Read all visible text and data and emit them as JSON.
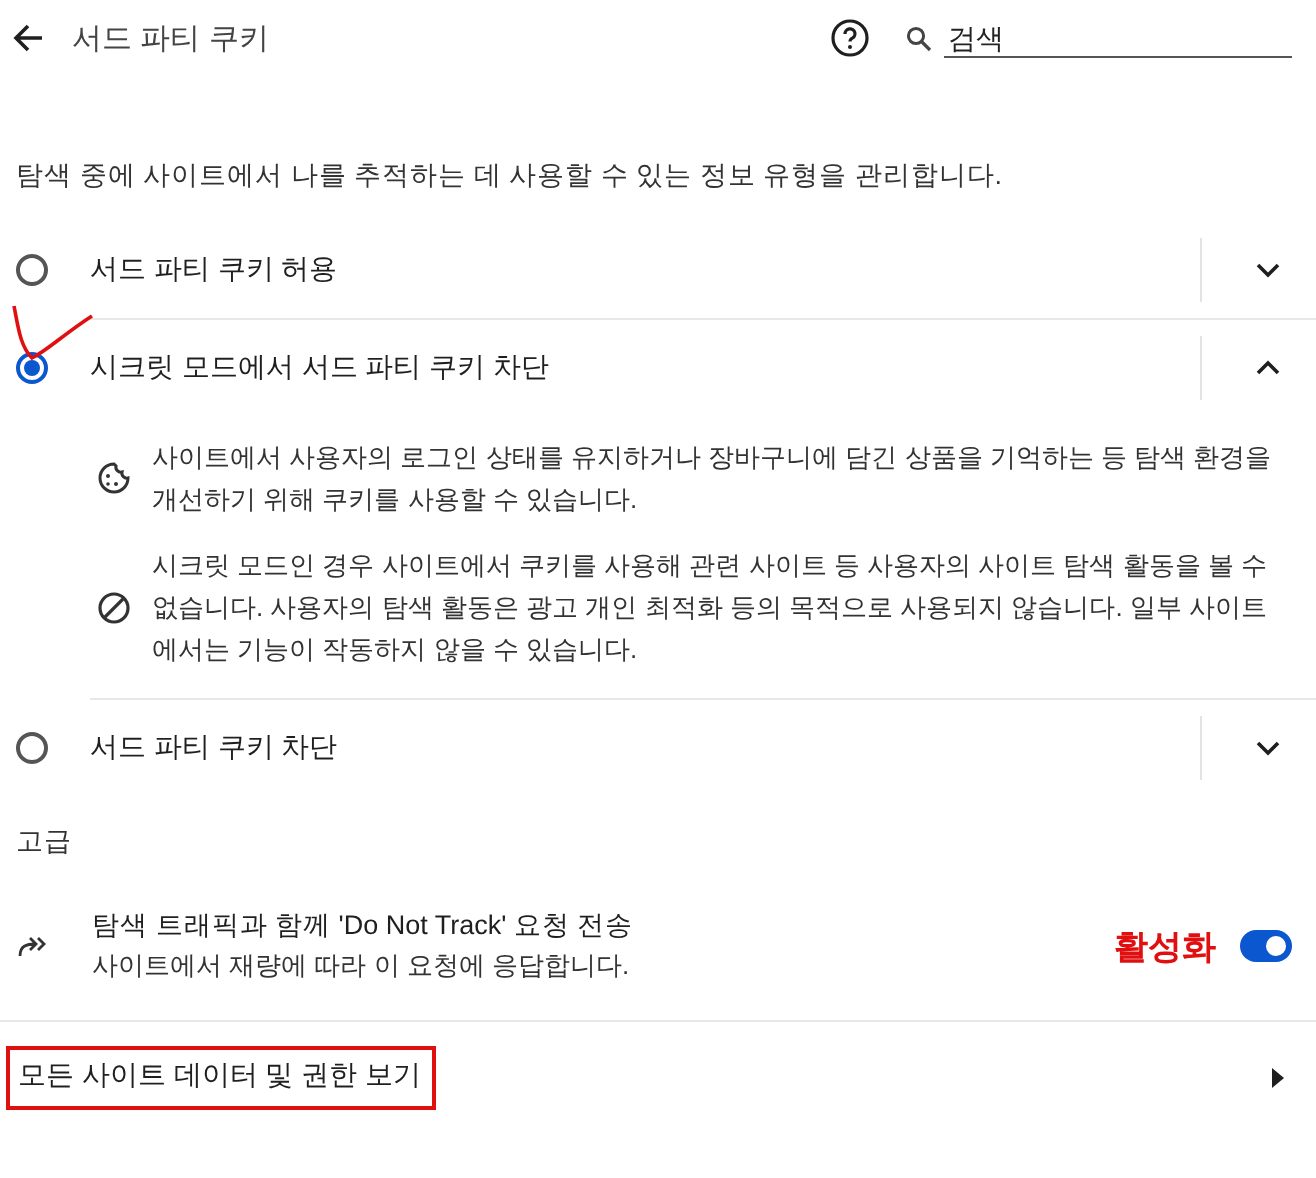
{
  "header": {
    "title": "서드 파티 쿠키",
    "search": {
      "placeholder": "검색"
    }
  },
  "description": "탐색 중에 사이트에서 나를 추적하는 데 사용할 수 있는 정보 유형을 관리합니다.",
  "options": [
    {
      "label": "서드 파티 쿠키 허용",
      "selected": false,
      "expanded": false
    },
    {
      "label": "시크릿 모드에서 서드 파티 쿠키 차단",
      "selected": true,
      "expanded": true,
      "details": [
        {
          "kind": "cookie",
          "text": "사이트에서 사용자의 로그인 상태를 유지하거나 장바구니에 담긴 상품을 기억하는 등 탐색 환경을 개선하기 위해 쿠키를 사용할 수 있습니다."
        },
        {
          "kind": "block",
          "text": "시크릿 모드인 경우 사이트에서 쿠키를 사용해 관련 사이트 등 사용자의 사이트 탐색 활동을 볼 수 없습니다. 사용자의 탐색 활동은 광고 개인 최적화 등의 목적으로 사용되지 않습니다. 일부 사이트에서는 기능이 작동하지 않을 수 있습니다."
        }
      ]
    },
    {
      "label": "서드 파티 쿠키 차단",
      "selected": false,
      "expanded": false
    }
  ],
  "advanced": {
    "heading": "고급",
    "dnt": {
      "title": "탐색 트래픽과 함께 'Do Not Track' 요청 전송",
      "subtitle": "사이트에서 재량에 따라 이 요청에 응답합니다.",
      "on": true,
      "annotation": "활성화"
    }
  },
  "link": {
    "label": "모든 사이트 데이터 및 권한 보기"
  }
}
